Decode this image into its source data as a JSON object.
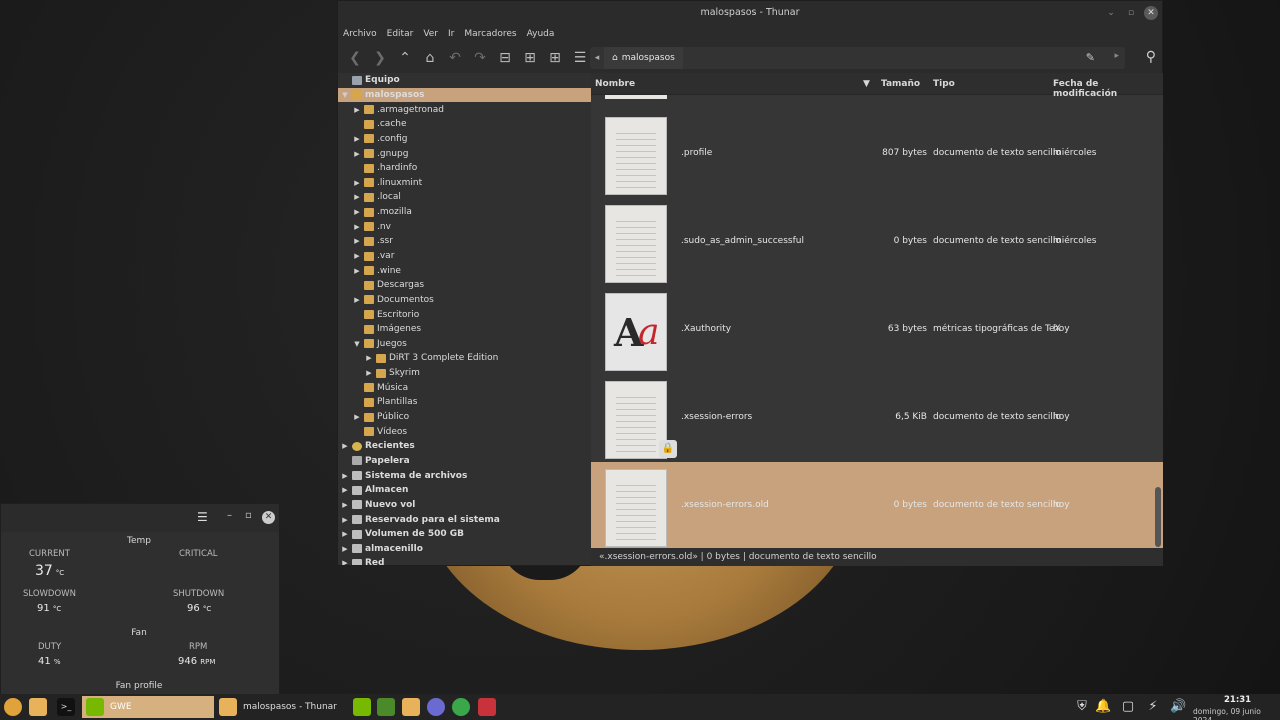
{
  "window": {
    "title": "malospasos - Thunar",
    "min": "⌄",
    "max": "▫",
    "close": "✕"
  },
  "menu": [
    "Archivo",
    "Editar",
    "Ver",
    "Ir",
    "Marcadores",
    "Ayuda"
  ],
  "toolbar": {
    "back": "❮",
    "forward": "❯",
    "up": "⌃",
    "home": "⌂",
    "undo": "↶",
    "redo": "↷",
    "minus": "⊟",
    "plus": "⊞",
    "grid": "⊞",
    "list": "☰"
  },
  "pathbar": {
    "crumb": "malospasos",
    "left_arrow": "◂",
    "right_arrow": "▸",
    "edit": "✎",
    "search": "⚲",
    "home_glyph": "⌂"
  },
  "sidebar": {
    "items": [
      {
        "label": "Equipo",
        "level": 0,
        "bold": true,
        "icon": "pc",
        "exp": ""
      },
      {
        "label": "malospasos",
        "level": 0,
        "bold": true,
        "icon": "home",
        "exp": "▼",
        "selected": true
      },
      {
        "label": ".armagetronad",
        "level": 1,
        "icon": "folder",
        "exp": "▶"
      },
      {
        "label": ".cache",
        "level": 1,
        "icon": "folder",
        "exp": ""
      },
      {
        "label": ".config",
        "level": 1,
        "icon": "folder",
        "exp": "▶"
      },
      {
        "label": ".gnupg",
        "level": 1,
        "icon": "folder",
        "exp": "▶"
      },
      {
        "label": ".hardinfo",
        "level": 1,
        "icon": "folder",
        "exp": ""
      },
      {
        "label": ".linuxmint",
        "level": 1,
        "icon": "folder",
        "exp": "▶"
      },
      {
        "label": ".local",
        "level": 1,
        "icon": "folder",
        "exp": "▶"
      },
      {
        "label": ".mozilla",
        "level": 1,
        "icon": "folder",
        "exp": "▶"
      },
      {
        "label": ".nv",
        "level": 1,
        "icon": "folder",
        "exp": "▶"
      },
      {
        "label": ".ssr",
        "level": 1,
        "icon": "folder",
        "exp": "▶"
      },
      {
        "label": ".var",
        "level": 1,
        "icon": "folder",
        "exp": "▶"
      },
      {
        "label": ".wine",
        "level": 1,
        "icon": "folder",
        "exp": "▶"
      },
      {
        "label": "Descargas",
        "level": 1,
        "icon": "folder",
        "exp": ""
      },
      {
        "label": "Documentos",
        "level": 1,
        "icon": "folder",
        "exp": "▶"
      },
      {
        "label": "Escritorio",
        "level": 1,
        "icon": "folder",
        "exp": ""
      },
      {
        "label": "Imágenes",
        "level": 1,
        "icon": "folder",
        "exp": ""
      },
      {
        "label": "Juegos",
        "level": 1,
        "icon": "folder",
        "exp": "▼"
      },
      {
        "label": "DiRT 3 Complete Edition",
        "level": 2,
        "icon": "folder",
        "exp": "▶"
      },
      {
        "label": "Skyrim",
        "level": 2,
        "icon": "folder",
        "exp": "▶"
      },
      {
        "label": "Música",
        "level": 1,
        "icon": "folder",
        "exp": ""
      },
      {
        "label": "Plantillas",
        "level": 1,
        "icon": "folder",
        "exp": ""
      },
      {
        "label": "Público",
        "level": 1,
        "icon": "folder",
        "exp": "▶"
      },
      {
        "label": "Vídeos",
        "level": 1,
        "icon": "folder",
        "exp": ""
      },
      {
        "label": "Recientes",
        "level": 0,
        "bold": true,
        "icon": "recent",
        "exp": "▶"
      },
      {
        "label": "Papelera",
        "level": 0,
        "bold": true,
        "icon": "trash",
        "exp": ""
      },
      {
        "label": "Sistema de archivos",
        "level": 0,
        "bold": true,
        "icon": "drive",
        "exp": "▶"
      },
      {
        "label": "Almacen",
        "level": 0,
        "bold": true,
        "icon": "drive",
        "exp": "▶"
      },
      {
        "label": "Nuevo vol",
        "level": 0,
        "bold": true,
        "icon": "drive",
        "exp": "▶"
      },
      {
        "label": "Reservado para el sistema",
        "level": 0,
        "bold": true,
        "icon": "drive",
        "exp": "▶"
      },
      {
        "label": "Volumen de 500 GB",
        "level": 0,
        "bold": true,
        "icon": "drive",
        "exp": "▶"
      },
      {
        "label": "almacenillo",
        "level": 0,
        "bold": true,
        "icon": "drive",
        "exp": "▶"
      },
      {
        "label": "Red",
        "level": 0,
        "bold": true,
        "icon": "drive",
        "exp": "▶"
      }
    ]
  },
  "columns": {
    "name": "Nombre",
    "size": "Tamaño",
    "type": "Tipo",
    "date": "Fecha de modificación",
    "sort_glyph": "▼"
  },
  "files": [
    {
      "name": ".profile",
      "size": "807 bytes",
      "type": "documento de texto sencillo",
      "date": "miércoles",
      "thumb": "text"
    },
    {
      "name": ".sudo_as_admin_successful",
      "size": "0 bytes",
      "type": "documento de texto sencillo",
      "date": "miércoles",
      "thumb": "text"
    },
    {
      "name": ".Xauthority",
      "size": "63 bytes",
      "type": "métricas tipográficas de TeX",
      "date": "hoy",
      "thumb": "font"
    },
    {
      "name": ".xsession-errors",
      "size": "6,5 KiB",
      "type": "documento de texto sencillo",
      "date": "hoy",
      "thumb": "text"
    },
    {
      "name": ".xsession-errors.old",
      "size": "0 bytes",
      "type": "documento de texto sencillo",
      "date": "hoy",
      "thumb": "text",
      "selected": true
    }
  ],
  "font_glyphs": {
    "a": "A",
    "b": "a"
  },
  "lock_glyph": "🔒",
  "statusbar": "«.xsession-errors.old»  |  0 bytes  |  documento de texto sencillo",
  "gwe": {
    "menu": "☰",
    "min": "–",
    "max": "▫",
    "close": "✕",
    "temp_title": "Temp",
    "current_label": "CURRENT",
    "current_value": "37",
    "current_unit": "°C",
    "critical_label": "CRITICAL",
    "slowdown_label": "SLOWDOWN",
    "slowdown_value": "91",
    "slowdown_unit": "°C",
    "shutdown_label": "SHUTDOWN",
    "shutdown_value": "96",
    "shutdown_unit": "°C",
    "fan_title": "Fan",
    "duty_label": "DUTY",
    "duty_value": "41",
    "duty_unit": "%",
    "rpm_label": "RPM",
    "rpm_value": "946",
    "rpm_unit": "RPM",
    "profile_title": "Fan profile"
  },
  "taskbar": {
    "gwe_label": "GWE",
    "thunar_label": "malospasos - Thunar",
    "time": "21:31",
    "date": "domingo, 09 junio 2024",
    "terminal_glyph": ">_",
    "tray": [
      "⛨",
      "🔔",
      "▢",
      "⚡",
      "🔊"
    ]
  }
}
